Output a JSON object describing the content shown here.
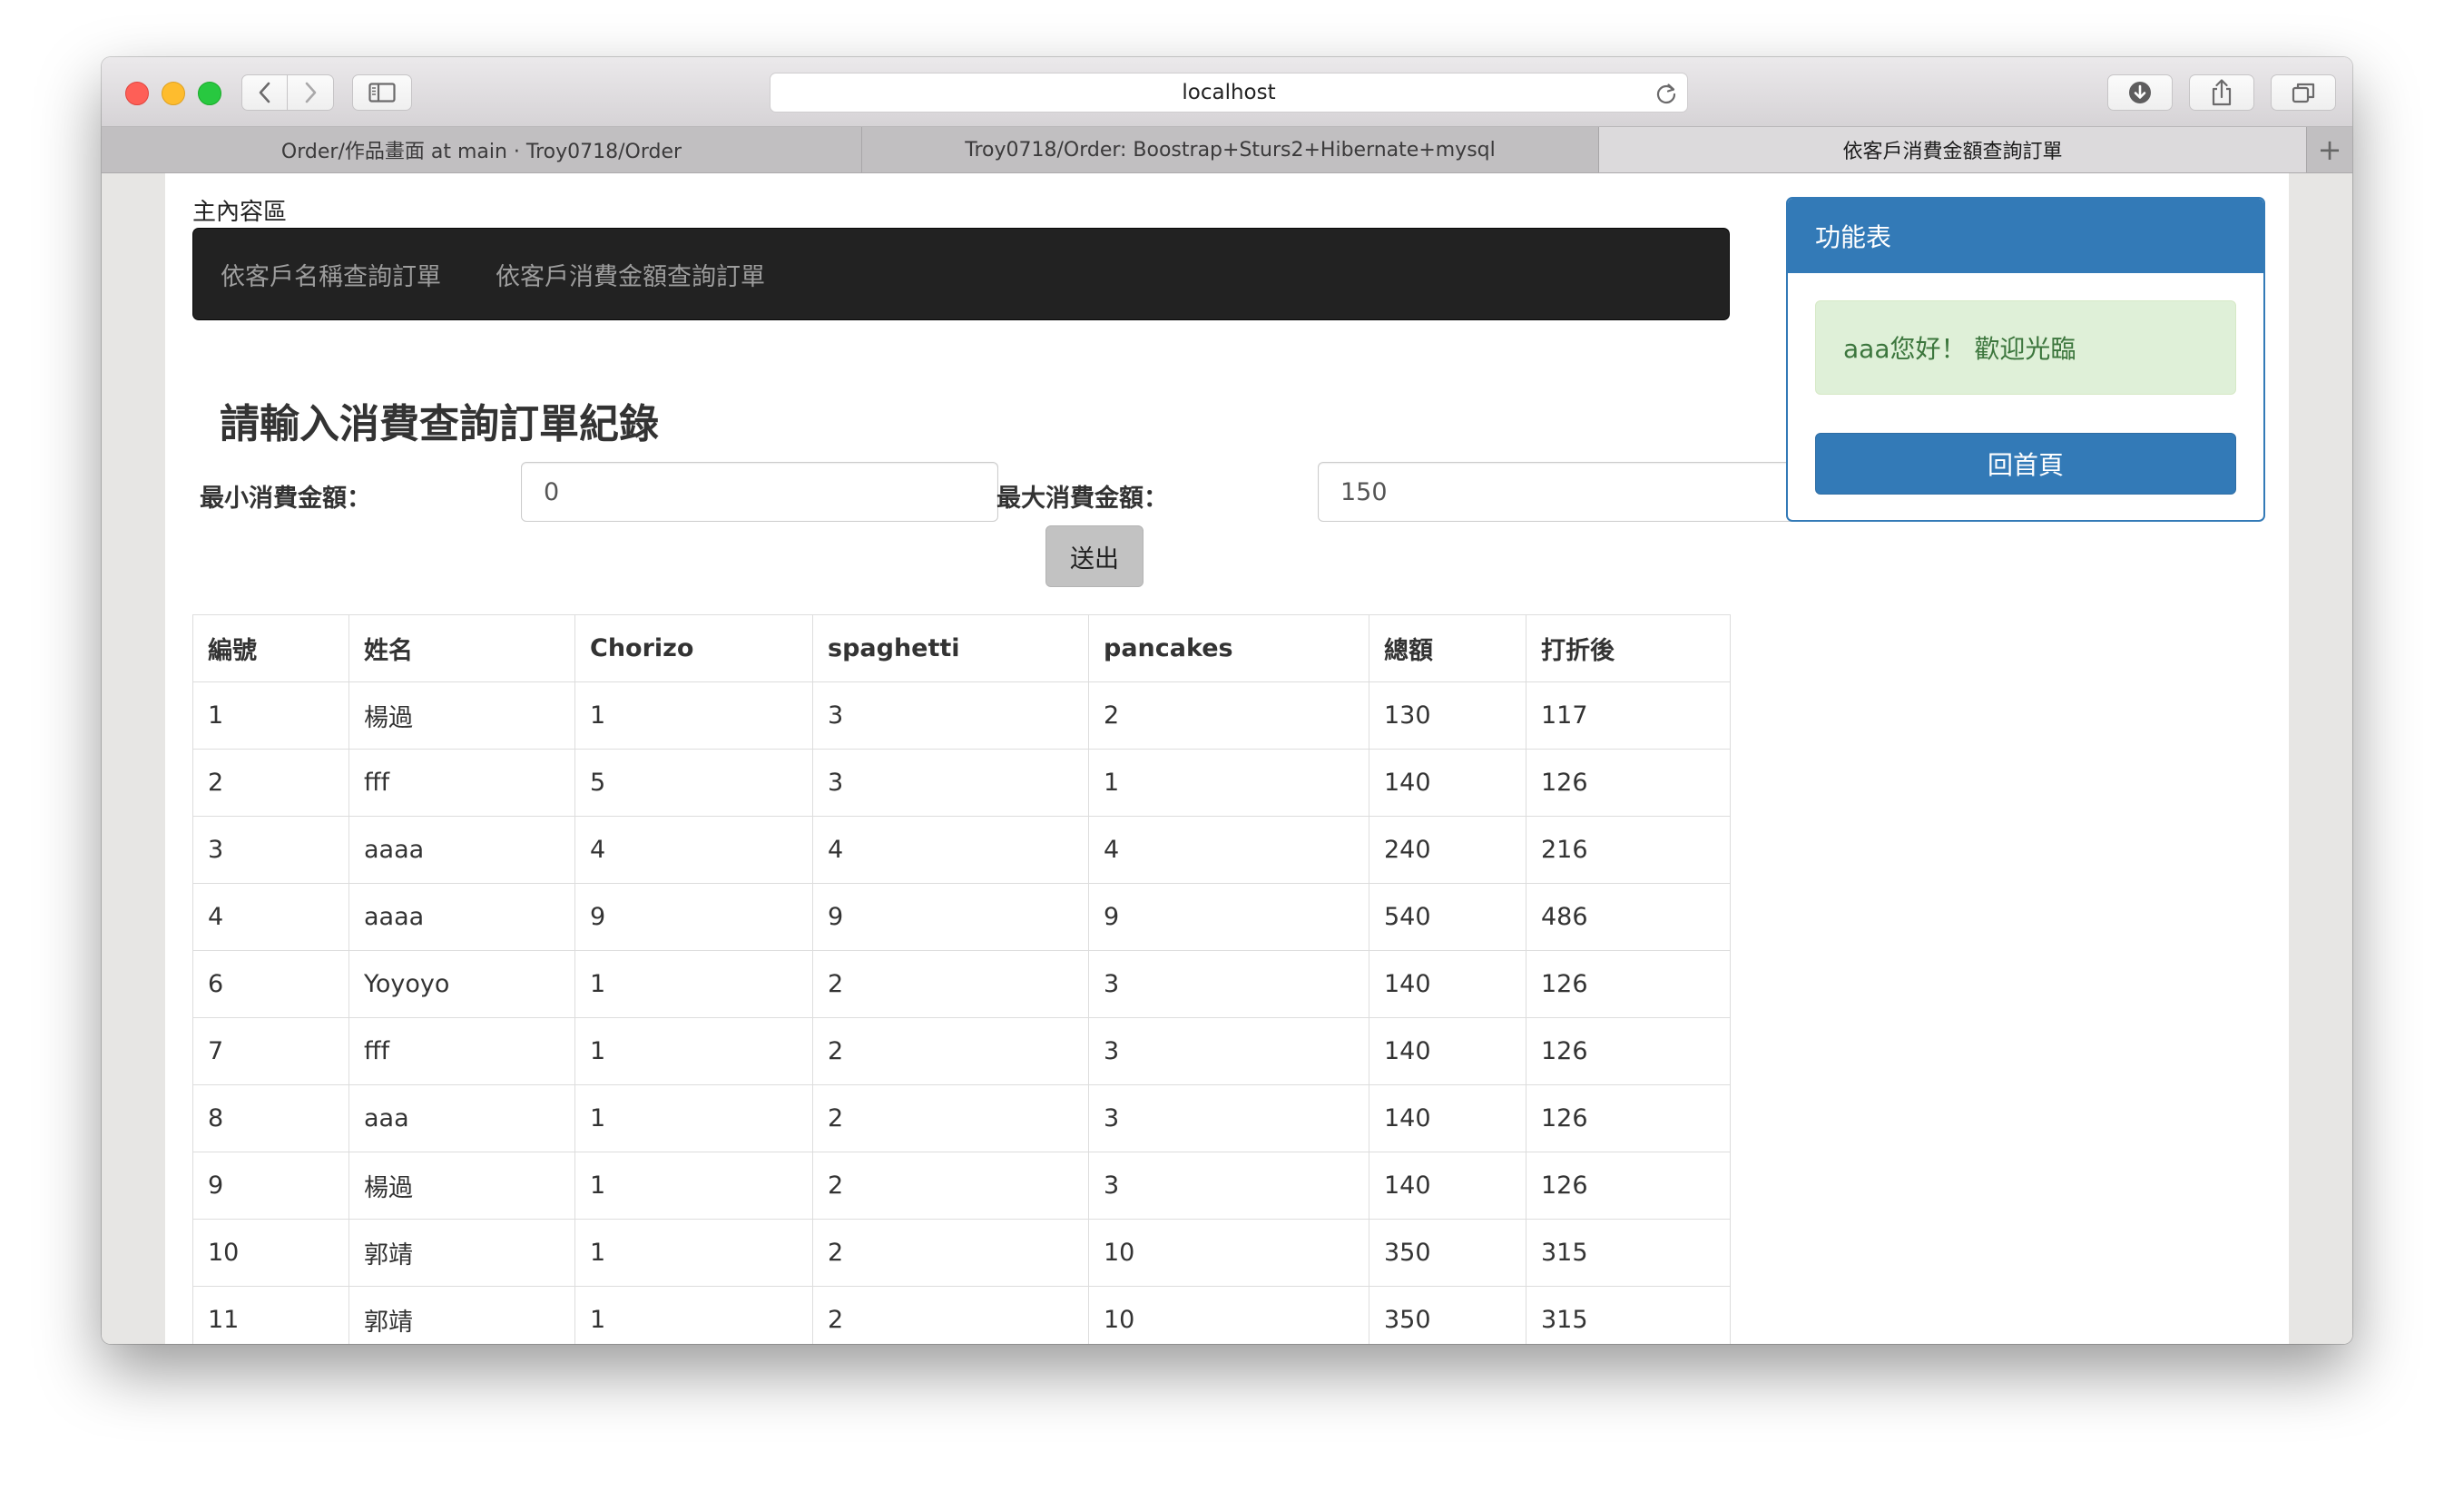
{
  "browser": {
    "address": "localhost",
    "tabs": [
      "Order/作品畫面 at main · Troy0718/Order",
      "Troy0718/Order: Boostrap+Sturs2+Hibernate+mysql",
      "依客戶消費金額查詢訂單"
    ],
    "new_tab_label": "+"
  },
  "main": {
    "section_label": "主內容區",
    "nav": [
      "依客戶名稱查詢訂單",
      "依客戶消費金額查詢訂單"
    ],
    "form": {
      "title": "請輸入消費查詢訂單紀錄",
      "min_label": "最小消費金額：",
      "min_value": "0",
      "max_label": "最大消費金額：",
      "max_value": "150",
      "submit_label": "送出"
    },
    "table": {
      "headers": [
        "編號",
        "姓名",
        "Chorizo",
        "spaghetti",
        "pancakes",
        "總額",
        "打折後"
      ],
      "rows": [
        [
          "1",
          "楊過",
          "1",
          "3",
          "2",
          "130",
          "117"
        ],
        [
          "2",
          "fff",
          "5",
          "3",
          "1",
          "140",
          "126"
        ],
        [
          "3",
          "aaaa",
          "4",
          "4",
          "4",
          "240",
          "216"
        ],
        [
          "4",
          "aaaa",
          "9",
          "9",
          "9",
          "540",
          "486"
        ],
        [
          "6",
          "Yoyoyo",
          "1",
          "2",
          "3",
          "140",
          "126"
        ],
        [
          "7",
          "fff",
          "1",
          "2",
          "3",
          "140",
          "126"
        ],
        [
          "8",
          "aaa",
          "1",
          "2",
          "3",
          "140",
          "126"
        ],
        [
          "9",
          "楊過",
          "1",
          "2",
          "3",
          "140",
          "126"
        ],
        [
          "10",
          "郭靖",
          "1",
          "2",
          "10",
          "350",
          "315"
        ],
        [
          "11",
          "郭靖",
          "1",
          "2",
          "10",
          "350",
          "315"
        ]
      ]
    }
  },
  "side": {
    "panel_title": "功能表",
    "welcome": "aaa您好！ 歡迎光臨",
    "home_button": "回首頁"
  },
  "colors": {
    "primary": "#337ab7",
    "navbar": "#222222",
    "success_bg": "#dff0d8",
    "success_text": "#3c763d"
  }
}
